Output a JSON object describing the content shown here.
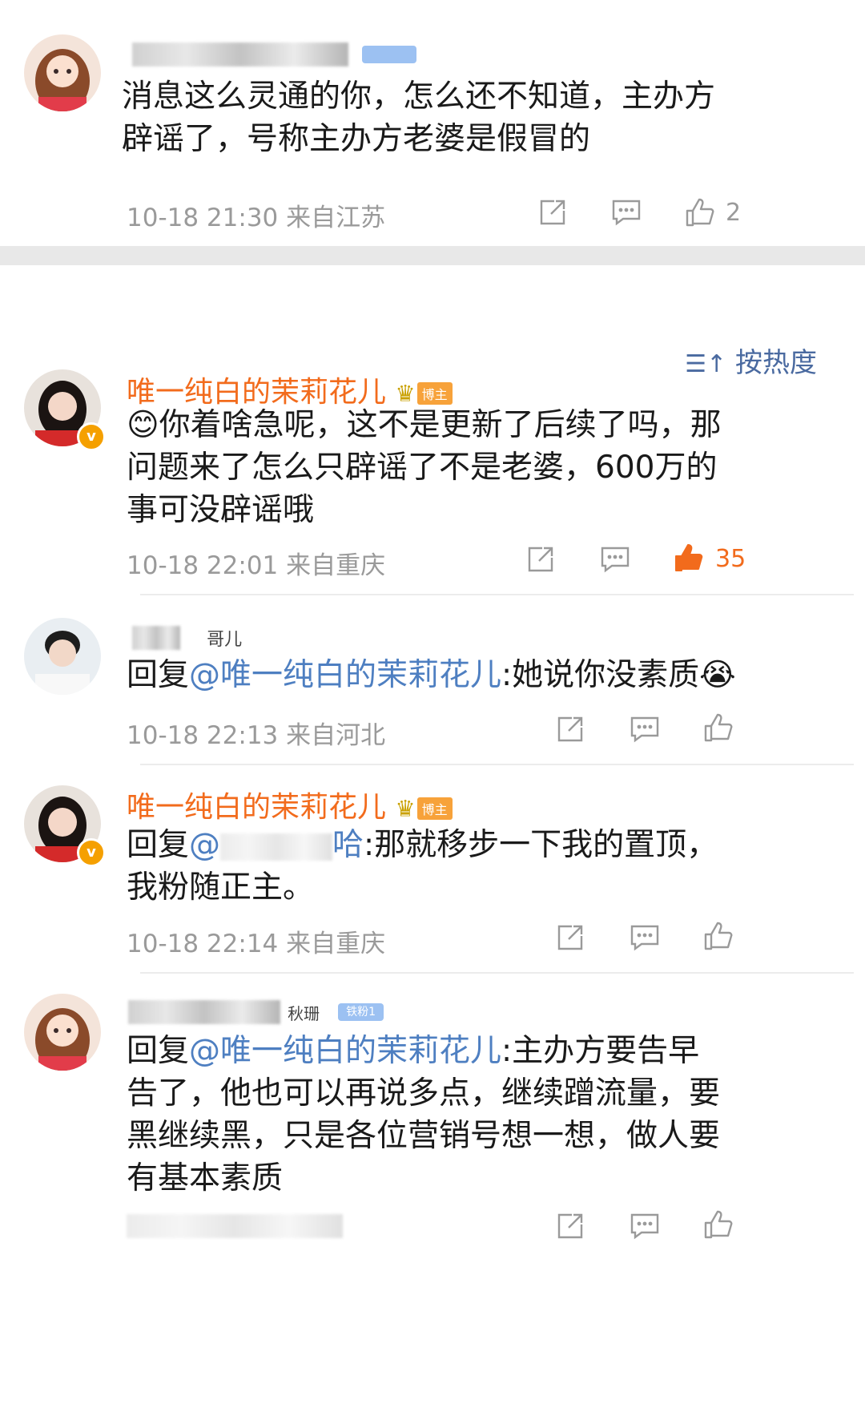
{
  "comments": [
    {
      "id": "c0",
      "username": "",
      "badge": "",
      "text": "消息这么灵通的你，怎么还不知道，主办方辟谣了，号称主办方老婆是假冒的",
      "meta": "10-18 21:30  来自江苏",
      "likes": "2"
    },
    {
      "id": "c1",
      "username": "唯一纯白的茉莉花儿",
      "badge": "博主",
      "emoji": "😊",
      "text": "你着啥急呢，这不是更新了后续了吗，那问题来了怎么只辟谣了不是老婆，600万的事可没辟谣哦",
      "meta": "10-18 22:01  来自重庆",
      "likes": "35"
    },
    {
      "id": "c2",
      "username_partial": "哥儿",
      "reply_prefix": "回复",
      "mention": "@唯一纯白的茉莉花儿",
      "text": ":她说你没素质",
      "emoji": "😭",
      "meta": "10-18 22:13  来自河北"
    },
    {
      "id": "c3",
      "username": "唯一纯白的茉莉花儿",
      "badge": "博主",
      "reply_prefix": "回复",
      "mention_start": "@",
      "mention_end": "哈",
      "text": ":那就移步一下我的置顶，我粉随正主。",
      "meta": "10-18 22:14  来自重庆"
    },
    {
      "id": "c4",
      "username_partial": "秋珊",
      "fan_badge": "铁粉1",
      "reply_prefix": "回复",
      "mention": "@唯一纯白的茉莉花儿",
      "text": ":主办方要告早告了，他也可以再说多点，继续蹭流量，要黑继续黑，只是各位营销号想一想，做人要有基本素质"
    }
  ],
  "sort_label": "按热度",
  "sort_icon": "sort-icon",
  "colors": {
    "username": "#f26b1c",
    "mention": "#4e7fc1",
    "meta": "#9a9a9a",
    "liked": "#f26b1c",
    "sort": "#4a6aa0"
  }
}
